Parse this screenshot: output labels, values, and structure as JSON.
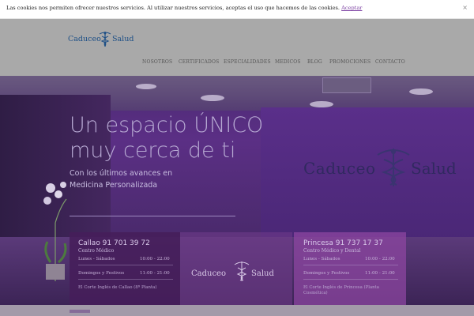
{
  "cookie": {
    "message": "Las cookies nos permiten ofrecer nuestros servicios. Al utilizar nuestros servicios, aceptas el uso que hacemos de las cookies.",
    "accept_label": "Aceptar",
    "close_label": "×"
  },
  "logo": {
    "part1": "Caduceo",
    "part2": "Salud"
  },
  "nav": {
    "items": [
      "NOSOTROS",
      "CERTIFICADOS",
      "ESPECIALIDADES",
      "MEDICOS",
      "BLOG",
      "PROMOCIONES",
      "CONTACTO"
    ]
  },
  "hero": {
    "title_line1": "Un espacio ÚNICO",
    "title_line2": "muy cerca de ti",
    "subtitle_line1": "Con los últimos avances en",
    "subtitle_line2": "Medicina Personalizada",
    "wall_logo": "Caduceo",
    "wall_logo_2": "Salud"
  },
  "clinics": [
    {
      "title": "Callao 91 701 39 72",
      "subtitle": "Centro Médico",
      "rows": [
        {
          "label": "Lunes - Sábados",
          "value": "10:00 - 22:00"
        },
        {
          "label": "Domingos y Festivos",
          "value": "11:00 - 21:00"
        }
      ],
      "footer": "El Corte Inglés de Callao (8ª Planta)"
    },
    {
      "title": "Princesa 91 737 17 37",
      "subtitle": "Centro Médico y Dental",
      "rows": [
        {
          "label": "Lunes - Sábados",
          "value": "10:00 - 22:00"
        },
        {
          "label": "Domingos y Festivos",
          "value": "11:00 - 21:00"
        }
      ],
      "footer": "El Corte Inglés de Princesa (Planta Cosmética)"
    }
  ],
  "center_logo": {
    "part1": "Caduceo",
    "part2": "Salud"
  },
  "colors": {
    "brand_blue": "#1d4f86",
    "purple": "#5b2f85",
    "accept_link": "#7a3ea1"
  }
}
